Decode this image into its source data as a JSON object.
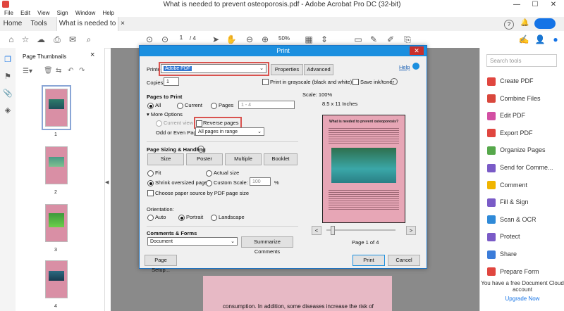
{
  "window": {
    "title": "What is needed to prevent osteoporosis.pdf - Adobe Acrobat Pro DC (32-bit)",
    "minimize": "—",
    "maximize": "☐",
    "close": "✕"
  },
  "menu": [
    "File",
    "Edit",
    "View",
    "Sign",
    "Window",
    "Help"
  ],
  "tabs": {
    "home": "Home",
    "tools": "Tools",
    "document": "What is needed to ...",
    "doc_close": "×"
  },
  "toolbar": {
    "page_current": "1",
    "page_total": "/ 4",
    "zoom": "50%"
  },
  "thumbs": {
    "title": "Page Thumbnails",
    "close": "×",
    "pages": [
      "1",
      "2",
      "3",
      "4"
    ]
  },
  "tools_panel": {
    "search_placeholder": "Search tools",
    "items": [
      "Create PDF",
      "Combine Files",
      "Edit PDF",
      "Export PDF",
      "Organize Pages",
      "Send for Comme...",
      "Comment",
      "Fill & Sign",
      "Scan & OCR",
      "Protect",
      "Share",
      "Prepare Form"
    ],
    "colors": [
      "#e0463f",
      "#d9473c",
      "#d34fa3",
      "#e0463f",
      "#56a84b",
      "#7a5bc7",
      "#f0b400",
      "#7a5bc7",
      "#2f8ad8",
      "#7a5bc7",
      "#3b7cd9",
      "#e0463f"
    ],
    "footer": "You have a free Document Cloud account",
    "upgrade": "Upgrade Now"
  },
  "doc_bottom_text": "consumption. In addition, some diseases increase the risk of",
  "dialog": {
    "title": "Print",
    "close": "✕",
    "printer_label": "Printer:",
    "printer_value": "Adobe PDF",
    "properties": "Properties",
    "advanced": "Advanced",
    "help": "Help",
    "copies_label": "Copies:",
    "copies_value": "1",
    "grayscale": "Print in grayscale (black and white)",
    "save_ink": "Save ink/toner",
    "pages_to_print": "Pages to Print",
    "all": "All",
    "current": "Current",
    "pages": "Pages",
    "pages_range": "1 - 4",
    "more_options": "More Options",
    "current_view": "Current view",
    "reverse_pages": "Reverse pages",
    "odd_even_label": "Odd or Even Pages:",
    "odd_even_value": "All pages in range",
    "sizing_heading": "Page Sizing & Handling",
    "size": "Size",
    "poster": "Poster",
    "multiple": "Multiple",
    "booklet": "Booklet",
    "fit": "Fit",
    "actual_size": "Actual size",
    "shrink": "Shrink oversized pages",
    "custom_scale": "Custom Scale:",
    "custom_scale_value": "100",
    "percent": "%",
    "choose_paper": "Choose paper source by PDF page size",
    "orientation": "Orientation:",
    "auto": "Auto",
    "portrait": "Portrait",
    "landscape": "Landscape",
    "comments_forms": "Comments & Forms",
    "comments_value": "Document",
    "summarize": "Summarize Comments",
    "page_setup": "Page Setup...",
    "print": "Print",
    "cancel": "Cancel",
    "scale": "Scale: 100%",
    "paper_size": "8.5 x 11 Inches",
    "preview_heading": "What is needed to prevent osteoporosis?",
    "page_of": "Page 1 of 4",
    "prev": "<",
    "next": ">"
  }
}
